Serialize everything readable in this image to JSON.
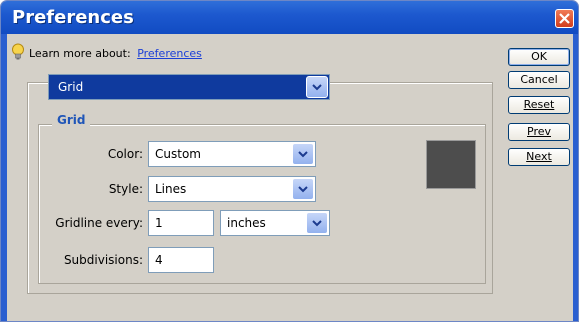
{
  "window": {
    "title": "Preferences",
    "close_icon": "close-icon"
  },
  "learn_more": {
    "prefix": "Learn more about:",
    "link": "Preferences",
    "icon": "lightbulb-icon"
  },
  "section_select": {
    "value": "Grid"
  },
  "grid_group": {
    "legend": "Grid",
    "color_label": "Color:",
    "color_value": "Custom",
    "style_label": "Style:",
    "style_value": "Lines",
    "gridline_label": "Gridline every:",
    "gridline_value": "1",
    "gridline_unit": "inches",
    "subdivisions_label": "Subdivisions:",
    "subdivisions_value": "4",
    "swatch_color": "#4d4d4d"
  },
  "buttons": {
    "ok": "OK",
    "cancel": "Cancel",
    "reset": "Reset",
    "prev": "Prev",
    "next": "Next"
  }
}
